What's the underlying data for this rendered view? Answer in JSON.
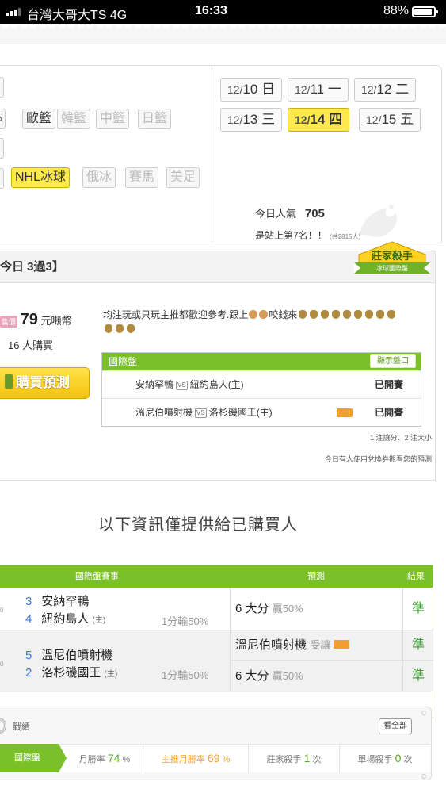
{
  "status_bar": {
    "carrier": "台灣大哥大TS  4G",
    "time": "16:33",
    "battery": "88%"
  },
  "categories": {
    "row1": [
      "歐籃",
      "韓籃",
      "中籃",
      "日籃"
    ],
    "row2": [
      "NHL冰球",
      "俄冰",
      "賽馬",
      "美足"
    ]
  },
  "dates": [
    {
      "day": "12/",
      "num": "10",
      "wd": "日"
    },
    {
      "day": "12/",
      "num": "11",
      "wd": "一"
    },
    {
      "day": "12/",
      "num": "12",
      "wd": "二"
    },
    {
      "day": "12/",
      "num": "13",
      "wd": "三"
    },
    {
      "day": "12/",
      "num": "14",
      "wd": "四"
    },
    {
      "day": "12/",
      "num": "15",
      "wd": "五"
    }
  ],
  "popularity": {
    "label": "今日人氣",
    "value": "705",
    "rank": "是站上第7名！！",
    "total": "(共2815人)"
  },
  "card": {
    "header": "今日 3過3】",
    "badge_title": "莊家殺手",
    "badge_sub": "冰球國際盤",
    "price_tag": "售價",
    "price": "79",
    "price_unit": "元噸幣",
    "buyers_num": "16",
    "buyers_unit": "人購買",
    "buy_button": "購買預測",
    "desc_text_1": "均注玩或只玩主推都歡迎參考.跟上",
    "desc_text_2": "咬錢來",
    "intl_header": "國際盤",
    "show_button": "顯示盤口",
    "games": [
      {
        "away": "安納罕鴨",
        "home": "紐約島人(主)",
        "result": "已開賽",
        "host": false
      },
      {
        "away": "溫尼伯噴射機",
        "home": "洛杉磯國王(主)",
        "result": "已開賽",
        "host": true
      }
    ],
    "vs": "VS",
    "note_rules": "1 注讓分、2 注大小",
    "note_coupon": "今日有人使用兌換券觀看您的預測"
  },
  "info_title": "以下資訊僅提供給已購買人",
  "prediction": {
    "headers": {
      "game": "國際盤賽事",
      "pred": "預測",
      "result": "結果"
    },
    "games": [
      {
        "t1_num": "3",
        "t1_name": "安納罕鴨",
        "t2_num": "4",
        "t2_name": "紐約島人",
        "t2_host": "(主)",
        "line": "1分輸50%",
        "picks": [
          {
            "pick": "6 大分",
            "sub": "贏50%",
            "result": "準"
          }
        ]
      },
      {
        "t1_num": "5",
        "t1_name": "溫尼伯噴射機",
        "t2_num": "2",
        "t2_name": "洛杉磯國王",
        "t2_host": "(主)",
        "line": "1分輸50%",
        "picks": [
          {
            "pick": "溫尼伯噴射機",
            "sub": "受讓",
            "result": "準"
          },
          {
            "pick": "6 大分",
            "sub": "贏50%",
            "result": "準"
          }
        ]
      }
    ]
  },
  "record": {
    "title": "戰績",
    "all_button": "看全部",
    "tab": "國際盤",
    "stats": [
      {
        "label": "月勝率",
        "value": "74",
        "unit": "%"
      },
      {
        "label": "主推月勝率",
        "value": "69",
        "unit": "%"
      },
      {
        "label": "莊家殺手",
        "value": "1",
        "unit": "次"
      },
      {
        "label": "單場殺手",
        "value": "0",
        "unit": "次"
      }
    ]
  },
  "colors": {
    "accent_green": "#7bbf2a",
    "highlight_yellow": "#ffe94d",
    "orange": "#f0a030",
    "blue_num": "#3a7bd5"
  }
}
